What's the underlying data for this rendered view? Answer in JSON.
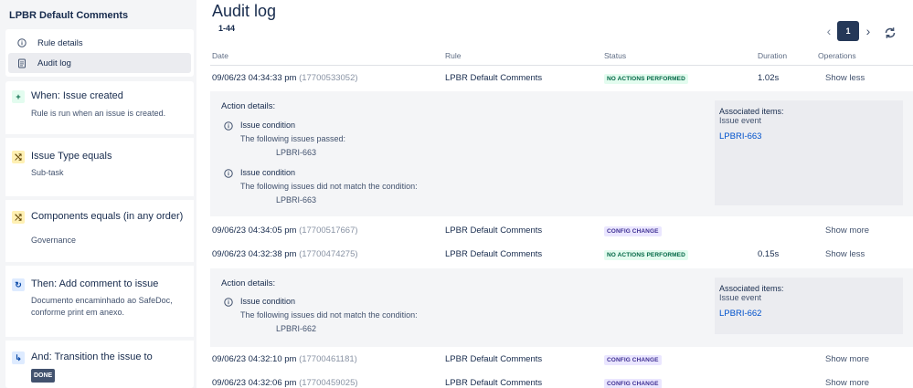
{
  "sidebar": {
    "title": "LPBR Default Comments",
    "nav": [
      {
        "label": "Rule details",
        "icon": "info-icon"
      },
      {
        "label": "Audit log",
        "icon": "clipboard-icon"
      }
    ],
    "steps": [
      {
        "title": "When: Issue created",
        "desc": "Rule is run when an issue is created.",
        "icon": "plus-icon"
      },
      {
        "title": "Issue Type equals",
        "desc": "Sub-task",
        "icon": "shuffle-icon"
      },
      {
        "title": "Components equals (in any order)",
        "desc": "Governance",
        "icon": "shuffle-icon"
      },
      {
        "title": "Then: Add comment to issue",
        "desc": "Documento encaminhado ao SafeDoc, conforme print em anexo.",
        "icon": "comment-icon"
      },
      {
        "title": "And: Transition the issue to",
        "badge": "DONE",
        "icon": "transition-icon"
      }
    ]
  },
  "main": {
    "title": "Audit log",
    "range": "1-44",
    "pagination": {
      "current": "1"
    },
    "columns": [
      "Date",
      "Rule",
      "Status",
      "Duration",
      "Operations"
    ]
  },
  "rows": [
    {
      "date": "09/06/23 04:34:33 pm",
      "exec": "(17700533052)",
      "rule": "LPBR Default Comments",
      "status": "NO ACTIONS PERFORMED",
      "duration": "1.02s",
      "action": "Show less"
    },
    {
      "date": "09/06/23 04:34:05 pm",
      "exec": "(17700517667)",
      "rule": "LPBR Default Comments",
      "status": "CONFIG CHANGE",
      "duration": "",
      "action": "Show more"
    },
    {
      "date": "09/06/23 04:32:38 pm",
      "exec": "(17700474275)",
      "rule": "LPBR Default Comments",
      "status": "NO ACTIONS PERFORMED",
      "duration": "0.15s",
      "action": "Show less"
    },
    {
      "date": "09/06/23 04:32:10 pm",
      "exec": "(17700461181)",
      "rule": "LPBR Default Comments",
      "status": "CONFIG CHANGE",
      "duration": "",
      "action": "Show more"
    },
    {
      "date": "09/06/23 04:32:06 pm",
      "exec": "(17700459025)",
      "rule": "LPBR Default Comments",
      "status": "CONFIG CHANGE",
      "duration": "",
      "action": "Show more"
    }
  ],
  "details": [
    {
      "heading": "Action details:",
      "conditions": [
        {
          "title": "Issue condition",
          "text": "The following issues passed:",
          "issue": "LPBRI-663"
        },
        {
          "title": "Issue condition",
          "text": "The following issues did not match the condition:",
          "issue": "LPBRI-663"
        }
      ],
      "assoc_title": "Associated items:",
      "assoc_sub": "Issue event",
      "assoc_link": "LPBRI-663"
    },
    {
      "heading": "Action details:",
      "conditions": [
        {
          "title": "Issue condition",
          "text": "The following issues did not match the condition:",
          "issue": "LPBRI-662"
        }
      ],
      "assoc_title": "Associated items:",
      "assoc_sub": "Issue event",
      "assoc_link": "LPBRI-662"
    }
  ],
  "colors": {
    "sidebar_bg": "#f4f5f7",
    "badge_green": "#006644",
    "badge_purple": "#403294",
    "link": "#0052cc",
    "pager_active": "#253858"
  }
}
